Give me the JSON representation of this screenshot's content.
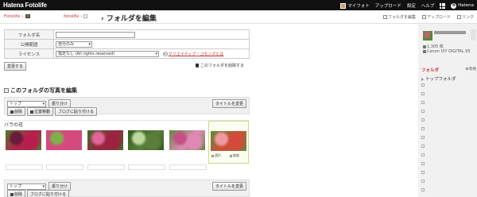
{
  "header": {
    "logo": "Hatena Fotolife",
    "nav": [
      {
        "label": "マイフォト",
        "icon": "user-icon"
      },
      {
        "label": "アップロード"
      },
      {
        "label": "設定"
      },
      {
        "label": "ヘルプ"
      },
      {
        "label": "Hatena",
        "icon": "hatena-mark"
      }
    ]
  },
  "titlebar": {
    "home_label": "Fotolife",
    "user_label": "fotolife",
    "page_title": "フォルダを編集",
    "tools": [
      "フォルダを編集",
      "アップロード",
      "リンク"
    ]
  },
  "form": {
    "rows": [
      {
        "label": "フォルダ名",
        "value": ""
      },
      {
        "label": "公開範囲",
        "value": "自分のみ"
      },
      {
        "label": "ライセンス",
        "value": "指定なし (All rights reserved)",
        "link": "クリエイティブ・コモンズとは"
      }
    ],
    "change_button": "変更する",
    "delete_link": "このフォルダを削除する"
  },
  "section": {
    "title": "このフォルダの写真を編集",
    "toolbar_top": {
      "folder_select": "トップ",
      "sort_button": "振り分け",
      "title_change_button": "タイトルを変更",
      "delete_button": "削除",
      "move_button": "位置移動",
      "blog_button": "ブログに貼り付ける"
    },
    "toolbar_bottom": {
      "folder_select": "トップ",
      "sort_button": "振り分け",
      "title_change_button": "タイトルを変更",
      "delete_button": "削除",
      "blog_button": "ブログに貼り付ける"
    }
  },
  "photos": [
    {
      "caption": "",
      "colors": [
        "#b81d4e",
        "#6a1a3a",
        "#4f7a2c"
      ]
    },
    {
      "caption": "",
      "colors": [
        "#d54a7e",
        "#7db24a",
        "#c7507a"
      ]
    },
    {
      "caption": "",
      "colors": [
        "#9e2240",
        "#e0669a",
        "#3d6f2a"
      ]
    },
    {
      "caption": "",
      "colors": [
        "#5a7f3a",
        "#bcd9a0",
        "#2d5a1e"
      ]
    },
    {
      "caption": "",
      "colors": [
        "#e089b5",
        "#c44f86",
        "#5d8b3a"
      ]
    },
    {
      "caption": "バラの花",
      "colors": [
        "#d44a3a",
        "#f09aa0",
        "#5e8c3a"
      ],
      "selected": true,
      "check1": "選択",
      "check2": "編集"
    }
  ],
  "sidebar": {
    "count": "1,305 枚",
    "camera": "Canon IXY DIGITAL 55",
    "folders_title": "フォルダ",
    "folders_new": "新規",
    "folder_top": "トップフォルダ"
  }
}
